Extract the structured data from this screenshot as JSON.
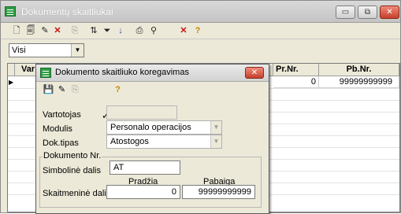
{
  "window": {
    "title": "Dokumentų skaitliukai",
    "min_label": "▭",
    "max_label": "⧉",
    "close_label": "✕"
  },
  "toolbar": {
    "icons": [
      "new-document-icon",
      "copy-document-icon",
      "edit-icon",
      "delete-icon",
      "paste-icon",
      "sort-icon",
      "filter-icon",
      "sort-az-icon",
      "print-icon",
      "find-icon",
      "clear-icon",
      "help-icon"
    ]
  },
  "filter": {
    "selected": "Visi"
  },
  "grid": {
    "columns": [
      "Var",
      "Pr.Nr.",
      "Pb.Nr."
    ],
    "rows": [
      {
        "pr_nr": "0",
        "pb_nr": "99999999999"
      }
    ]
  },
  "dialog": {
    "title": "Dokumento skaitliuko koregavimas",
    "close_label": "✕",
    "labels": {
      "user": "Vartotojas",
      "module": "Modulis",
      "doc_type": "Dok.tipas",
      "group_title": "Dokumento Nr.",
      "symbolic": "Simbolinė dalis",
      "start": "Pradžia",
      "end": "Pabaiga",
      "numeric": "Skaitmeninė dalis"
    },
    "values": {
      "user": "",
      "module": "Personalo operacijos",
      "doc_type": "Atostogos",
      "symbolic": "AT",
      "start": "0",
      "end": "99999999999"
    }
  }
}
